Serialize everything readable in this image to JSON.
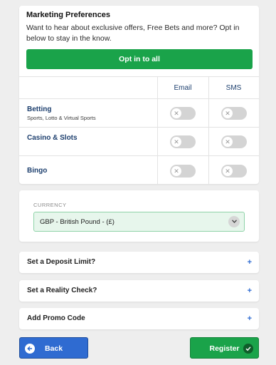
{
  "marketing": {
    "title": "Marketing Preferences",
    "description": "Want to hear about exclusive offers, Free Bets and more? Opt in below to stay in the know.",
    "opt_in_all_label": "Opt in to all",
    "columns": {
      "email": "Email",
      "sms": "SMS"
    },
    "rows": [
      {
        "label": "Betting",
        "sublabel": "Sports, Lotto & Virtual Sports",
        "email_on": false,
        "sms_on": false
      },
      {
        "label": "Casino & Slots",
        "sublabel": "",
        "email_on": false,
        "sms_on": false
      },
      {
        "label": "Bingo",
        "sublabel": "",
        "email_on": false,
        "sms_on": false
      }
    ]
  },
  "currency": {
    "label": "CURRENCY",
    "selected": "GBP - British Pound - (£)"
  },
  "accordions": {
    "deposit_limit": "Set a Deposit Limit?",
    "reality_check": "Set a Reality Check?",
    "promo_code": "Add Promo Code"
  },
  "buttons": {
    "back": "Back",
    "register": "Register"
  },
  "colors": {
    "primary_green": "#1aa34a",
    "primary_blue": "#2f6bd1",
    "label_navy": "#1d3f6e",
    "toggle_off": "#d4d4d4"
  },
  "icons": {
    "toggle_knob": "close-icon",
    "currency_dropdown": "chevron-down-icon",
    "accordion": "plus-icon",
    "back": "arrow-left-icon",
    "register": "check-icon"
  }
}
